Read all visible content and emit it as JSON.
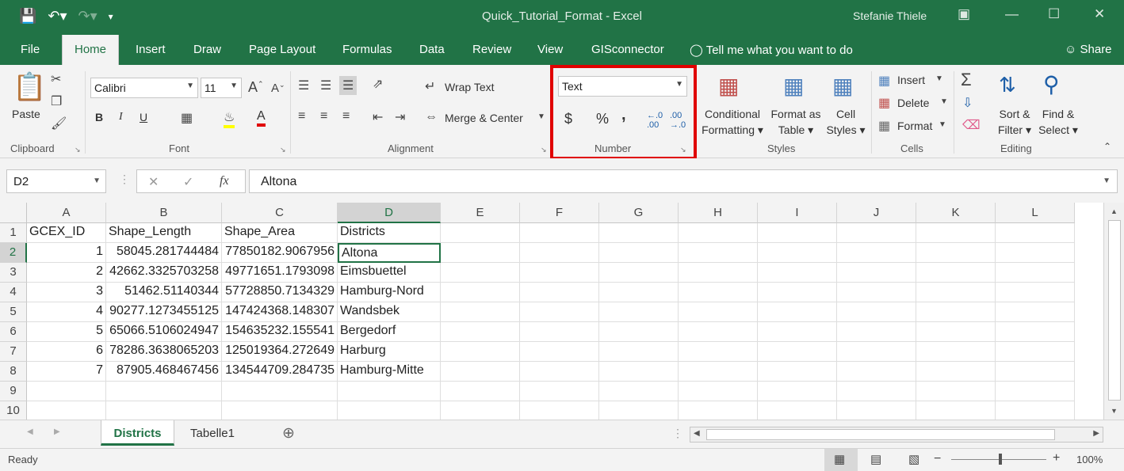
{
  "window": {
    "title": "Quick_Tutorial_Format  -  Excel",
    "user": "Stefanie Thiele"
  },
  "ribbon_tabs": [
    "File",
    "Home",
    "Insert",
    "Draw",
    "Page Layout",
    "Formulas",
    "Data",
    "Review",
    "View",
    "GISconnector"
  ],
  "tell_me": "Tell me what you want to do",
  "share": "Share",
  "clipboard": {
    "paste": "Paste",
    "label": "Clipboard"
  },
  "font": {
    "name": "Calibri",
    "size": "11",
    "label": "Font",
    "bold": "B",
    "italic": "I",
    "underline": "U"
  },
  "alignment": {
    "wrap": "Wrap Text",
    "merge": "Merge & Center",
    "label": "Alignment"
  },
  "number": {
    "format": "Text",
    "currency": "$",
    "percent": "%",
    "comma": ",",
    "label": "Number"
  },
  "styles": {
    "cond_line1": "Conditional",
    "cond_line2": "Formatting",
    "table_line1": "Format as",
    "table_line2": "Table",
    "cell_line1": "Cell",
    "cell_line2": "Styles",
    "label": "Styles"
  },
  "cells": {
    "insert": "Insert",
    "delete": "Delete",
    "format": "Format",
    "label": "Cells"
  },
  "editing": {
    "sort_line1": "Sort &",
    "sort_line2": "Filter",
    "find_line1": "Find &",
    "find_line2": "Select",
    "label": "Editing"
  },
  "formula_bar": {
    "name_box": "D2",
    "content": "Altona",
    "fx": "fx"
  },
  "columns": [
    "A",
    "B",
    "C",
    "D",
    "E",
    "F",
    "G",
    "H",
    "I",
    "J",
    "K",
    "L"
  ],
  "rows": [
    "1",
    "2",
    "3",
    "4",
    "5",
    "6",
    "7",
    "8",
    "9",
    "10"
  ],
  "table": {
    "header": [
      "GCEX_ID",
      "Shape_Length",
      "Shape_Area",
      "Districts"
    ],
    "data": [
      [
        "1",
        "58045.281744484",
        "77850182.9067956",
        "Altona"
      ],
      [
        "2",
        "42662.3325703258",
        "49771651.1793098",
        "Eimsbuettel"
      ],
      [
        "3",
        "51462.51140344",
        "57728850.7134329",
        "Hamburg-Nord"
      ],
      [
        "4",
        "90277.1273455125",
        "147424368.148307",
        "Wandsbek"
      ],
      [
        "5",
        "65066.5106024947",
        "154635232.155541",
        "Bergedorf"
      ],
      [
        "6",
        "78286.3638065203",
        "125019364.272649",
        "Harburg"
      ],
      [
        "7",
        "87905.468467456",
        "134544709.284735",
        "Hamburg-Mitte"
      ]
    ]
  },
  "sheets": [
    "Districts",
    "Tabelle1"
  ],
  "status": {
    "ready": "Ready",
    "zoom": "100%"
  },
  "colors": {
    "accent": "#217346",
    "highlight_box": "#e00000"
  }
}
